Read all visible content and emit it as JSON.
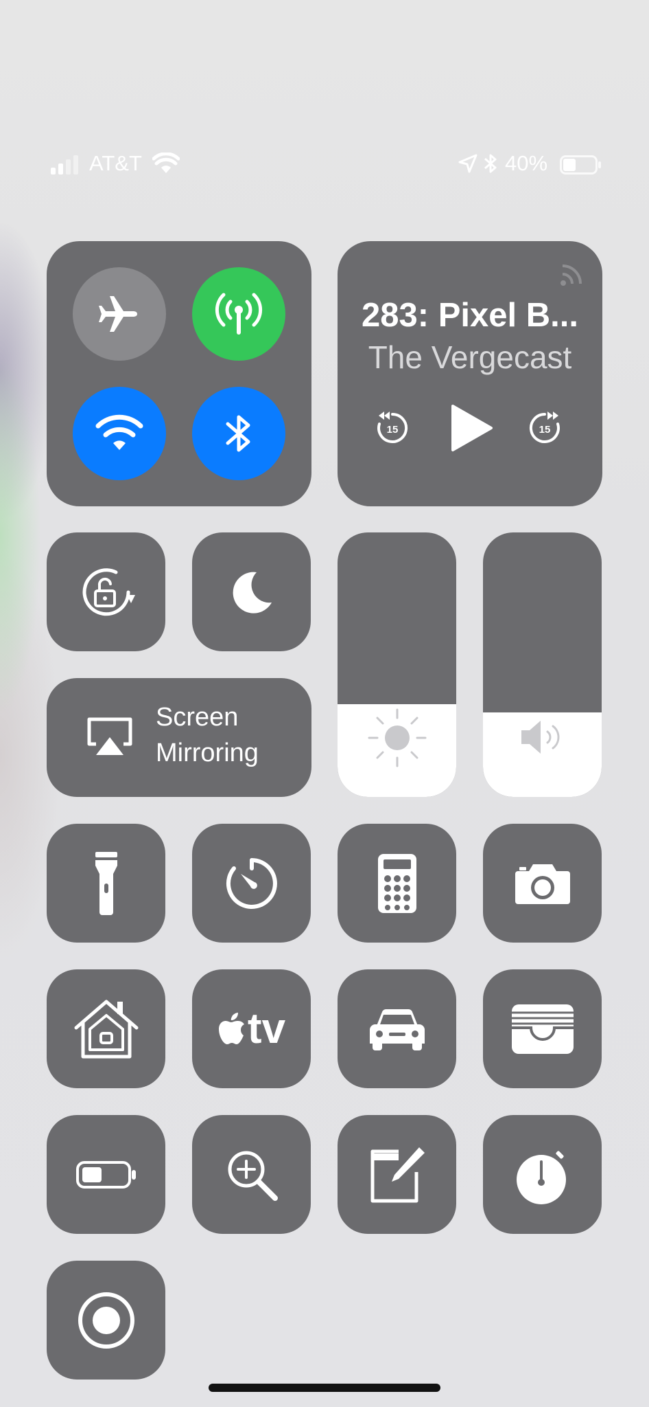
{
  "status_bar": {
    "carrier": "AT&T",
    "battery_percent": "40%",
    "battery_level": 0.4
  },
  "media": {
    "title": "283: Pixel B...",
    "subtitle": "The Vergecast",
    "skip_back_seconds": "15",
    "skip_forward_seconds": "15"
  },
  "screen_mirroring": {
    "line1": "Screen",
    "line2": "Mirroring"
  },
  "sliders": {
    "brightness_level": 0.35,
    "volume_level": 0.32
  },
  "colors": {
    "tile": "#6b6b6e",
    "cellular_active": "#35c759",
    "wifi_active": "#0a7cff",
    "bluetooth_active": "#0a7cff",
    "airplane_inactive": "#8a8a8d"
  },
  "controls": [
    "flashlight-icon",
    "timer-icon",
    "calculator-icon",
    "camera-icon",
    "home-icon",
    "apple-tv-icon",
    "car-icon",
    "wallet-icon",
    "low-power-icon",
    "magnifier-icon",
    "notes-icon",
    "stopwatch-icon",
    "screen-record-icon"
  ],
  "apple_tv_label": "tv"
}
